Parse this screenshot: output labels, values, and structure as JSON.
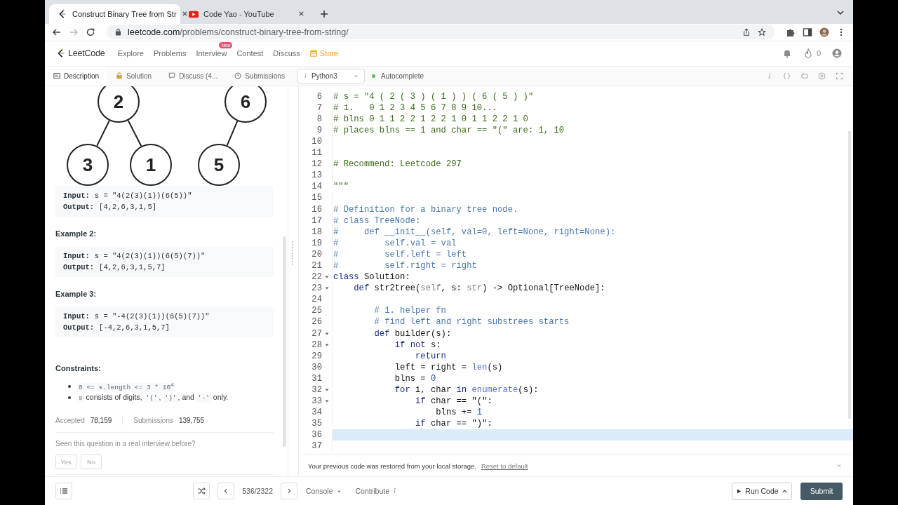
{
  "browser": {
    "tabs": [
      {
        "title": "Construct Binary Tree from Str",
        "kind": "leetcode",
        "selected": true
      },
      {
        "title": "Code Yao - YouTube",
        "kind": "video",
        "selected": false
      }
    ],
    "url_host": "leetcode.com",
    "url_path": "/problems/construct-binary-tree-from-string/"
  },
  "nav": {
    "logo": "LeetCode",
    "items": [
      {
        "label": "Explore",
        "kind": "link"
      },
      {
        "label": "Problems",
        "kind": "link"
      },
      {
        "label": "Interview",
        "kind": "link",
        "badge": "New"
      },
      {
        "label": "Contest",
        "kind": "link"
      },
      {
        "label": "Discuss",
        "kind": "link"
      },
      {
        "label": "Store",
        "kind": "store"
      }
    ],
    "streak": "0"
  },
  "panel_tabs": [
    {
      "label": "Description",
      "kind": "doc",
      "selected": true
    },
    {
      "label": "Solution",
      "kind": "lock",
      "selected": false
    },
    {
      "label": "Discuss (4...",
      "kind": "chat",
      "selected": false
    },
    {
      "label": "Submissions",
      "kind": "clock",
      "selected": false
    }
  ],
  "language": "Python3",
  "autocomplete": {
    "label": "Autocomplete",
    "on": true
  },
  "tree": {
    "nodes": [
      {
        "label": "2"
      },
      {
        "label": "6"
      },
      {
        "label": "3"
      },
      {
        "label": "1"
      },
      {
        "label": "5"
      }
    ]
  },
  "examples": [
    {
      "input_label": "Input:",
      "input": "s = \"4(2(3)(1))(6(5))\"",
      "output_label": "Output:",
      "output": "[4,2,6,3,1,5]"
    },
    {
      "title": "Example 2:",
      "input_label": "Input:",
      "input": "s = \"4(2(3)(1))(6(5)(7))\"",
      "output_label": "Output:",
      "output": "[4,2,6,3,1,5,7]"
    },
    {
      "title": "Example 3:",
      "input_label": "Input:",
      "input": "s = \"-4(2(3)(1))(6(5)(7))\"",
      "output_label": "Output:",
      "output": "[-4,2,6,3,1,5,7]"
    }
  ],
  "constraints": {
    "title": "Constraints:",
    "items": [
      [
        {
          "t": "0 <= s.length <= 3 * 10$^{4}$",
          "kind": "code"
        }
      ],
      [
        {
          "t": "s",
          "kind": "code"
        },
        {
          "t": " consists of digits, ",
          "kind": "text"
        },
        {
          "t": "'('",
          "kind": "code"
        },
        {
          "t": ", ",
          "kind": "text"
        },
        {
          "t": "')'",
          "kind": "code"
        },
        {
          "t": ", and ",
          "kind": "text"
        },
        {
          "t": "'-'",
          "kind": "code"
        },
        {
          "t": " only.",
          "kind": "text"
        }
      ]
    ]
  },
  "stats": [
    {
      "label": "Accepted",
      "value": "78,159"
    },
    {
      "label": "Submissions",
      "value": "139,755"
    }
  ],
  "interview": {
    "question": "Seen this question in a real interview before?",
    "buttons": [
      "Yes",
      "No"
    ]
  },
  "editor": {
    "lines": [
      {
        "n": "6",
        "fold": false,
        "active": false,
        "tokens": [
          {
            "t": "# s = \"4 ( 2 ( 3 ) ( 1 ) ) ( 6 ( 5 ) )\"",
            "kind": "string"
          }
        ]
      },
      {
        "n": "7",
        "fold": false,
        "active": false,
        "tokens": [
          {
            "t": "# i.   0 1 2 3 4 5 6 7 8 9 10...",
            "kind": "string"
          }
        ]
      },
      {
        "n": "8",
        "fold": false,
        "active": false,
        "tokens": [
          {
            "t": "# blns 0 1 1 2 2 1 2 2 1 0 1 1 2 2 1 0",
            "kind": "string"
          }
        ]
      },
      {
        "n": "9",
        "fold": false,
        "active": false,
        "tokens": [
          {
            "t": "# places blns == 1 and char == \"(\" are: 1, 10",
            "kind": "string"
          }
        ]
      },
      {
        "n": "10",
        "fold": false,
        "active": false
      },
      {
        "n": "11",
        "fold": false,
        "active": false
      },
      {
        "n": "12",
        "fold": false,
        "active": false,
        "tokens": [
          {
            "t": "# Recommend: Leetcode 297",
            "kind": "string"
          }
        ]
      },
      {
        "n": "13",
        "fold": false,
        "active": false
      },
      {
        "n": "14",
        "fold": false,
        "active": false,
        "tokens": [
          {
            "t": "\"\"\"",
            "kind": "string"
          }
        ]
      },
      {
        "n": "15",
        "fold": false,
        "active": false
      },
      {
        "n": "16",
        "fold": false,
        "active": false,
        "tokens": [
          {
            "t": "# Definition for a binary tree node.",
            "kind": "comment"
          }
        ]
      },
      {
        "n": "17",
        "fold": false,
        "active": false,
        "tokens": [
          {
            "t": "# class TreeNode:",
            "kind": "comment"
          }
        ]
      },
      {
        "n": "18",
        "fold": false,
        "active": false,
        "tokens": [
          {
            "t": "#     def __init__(self, val=0, left=None, right=None):",
            "kind": "comment"
          }
        ]
      },
      {
        "n": "19",
        "fold": false,
        "active": false,
        "tokens": [
          {
            "t": "#         self.val = val",
            "kind": "comment"
          }
        ]
      },
      {
        "n": "20",
        "fold": false,
        "active": false,
        "tokens": [
          {
            "t": "#         self.left = left",
            "kind": "comment"
          }
        ]
      },
      {
        "n": "21",
        "fold": false,
        "active": false,
        "tokens": [
          {
            "t": "#         self.right = right",
            "kind": "comment"
          }
        ]
      },
      {
        "n": "22",
        "fold": true,
        "active": false,
        "tokens": [
          {
            "t": "class",
            "kind": "keyword"
          },
          {
            "t": " Solution:",
            "kind": "plain"
          }
        ]
      },
      {
        "n": "23",
        "fold": true,
        "active": false,
        "tokens": [
          {
            "t": "    def",
            "kind": "keyword"
          },
          {
            "t": " str2tree(",
            "kind": "plain"
          },
          {
            "t": "self",
            "kind": "self"
          },
          {
            "t": ", s: ",
            "kind": "plain"
          },
          {
            "t": "str",
            "kind": "self"
          },
          {
            "t": ") -> Optional[TreeNode]:",
            "kind": "plain"
          }
        ]
      },
      {
        "n": "24",
        "fold": false,
        "active": false
      },
      {
        "n": "25",
        "fold": false,
        "active": false,
        "tokens": [
          {
            "t": "        # 1. helper fn",
            "kind": "comment"
          }
        ]
      },
      {
        "n": "26",
        "fold": false,
        "active": false,
        "tokens": [
          {
            "t": "        # find left and right substrees starts",
            "kind": "comment"
          }
        ]
      },
      {
        "n": "27",
        "fold": true,
        "active": false,
        "tokens": [
          {
            "t": "        def",
            "kind": "keyword"
          },
          {
            "t": " builder(s):",
            "kind": "plain"
          }
        ]
      },
      {
        "n": "28",
        "fold": true,
        "active": false,
        "tokens": [
          {
            "t": "            if not",
            "kind": "keyword"
          },
          {
            "t": " s:",
            "kind": "plain"
          }
        ]
      },
      {
        "n": "29",
        "fold": false,
        "active": false,
        "tokens": [
          {
            "t": "                return",
            "kind": "keyword"
          }
        ]
      },
      {
        "n": "30",
        "fold": false,
        "active": false,
        "tokens": [
          {
            "t": "            left = right = ",
            "kind": "plain"
          },
          {
            "t": "len",
            "kind": "builtin"
          },
          {
            "t": "(s)",
            "kind": "plain"
          }
        ]
      },
      {
        "n": "31",
        "fold": false,
        "active": false,
        "tokens": [
          {
            "t": "            blns = ",
            "kind": "plain"
          },
          {
            "t": "0",
            "kind": "number"
          }
        ]
      },
      {
        "n": "32",
        "fold": true,
        "active": false,
        "tokens": [
          {
            "t": "            for",
            "kind": "keyword"
          },
          {
            "t": " i, char ",
            "kind": "plain"
          },
          {
            "t": "in",
            "kind": "keyword"
          },
          {
            "t": " enumerate",
            "kind": "builtin"
          },
          {
            "t": "(s):",
            "kind": "plain"
          }
        ]
      },
      {
        "n": "33",
        "fold": true,
        "active": false,
        "tokens": [
          {
            "t": "                if",
            "kind": "keyword"
          },
          {
            "t": " char == \"(\":",
            "kind": "plain"
          }
        ]
      },
      {
        "n": "34",
        "fold": false,
        "active": false,
        "tokens": [
          {
            "t": "                    blns += ",
            "kind": "plain"
          },
          {
            "t": "1",
            "kind": "number"
          }
        ]
      },
      {
        "n": "35",
        "fold": false,
        "active": false,
        "tokens": [
          {
            "t": "                if",
            "kind": "keyword"
          },
          {
            "t": " char == \")\":",
            "kind": "plain"
          }
        ]
      },
      {
        "n": "36",
        "fold": false,
        "active": true
      },
      {
        "n": "37",
        "fold": false,
        "active": false
      }
    ],
    "notice": "Your previous code was restored from your local storage.",
    "notice_link": "Reset to default"
  },
  "bottom": {
    "page": "536/2322",
    "console": "Console",
    "contribute": "Contribute",
    "run": "Run Code",
    "submit": "Submit"
  }
}
